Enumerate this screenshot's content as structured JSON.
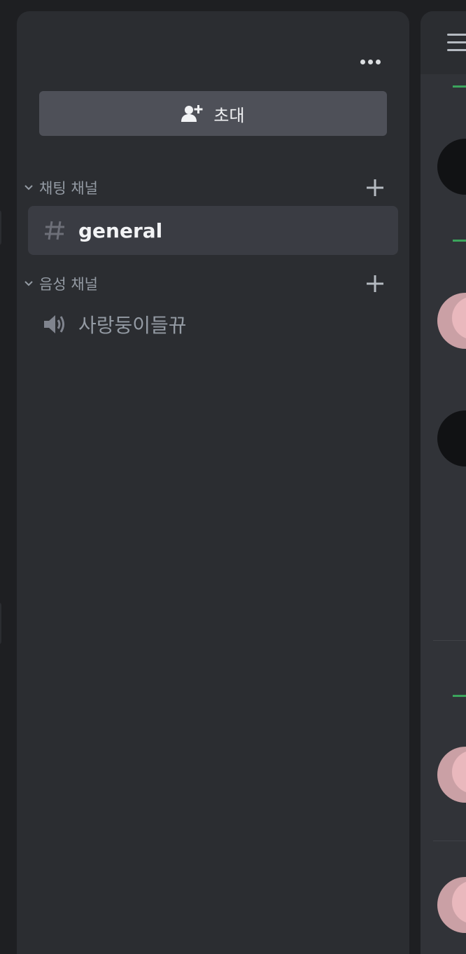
{
  "panel": {
    "more_icon": "more-horizontal-icon",
    "invite": {
      "label": "초대",
      "icon": "add-user-icon"
    },
    "categories": [
      {
        "label": "채팅 채널",
        "chevron_icon": "chevron-down-icon",
        "add_icon": "plus-icon",
        "channels": [
          {
            "label": "general",
            "icon": "hash-icon",
            "active": true
          }
        ]
      },
      {
        "label": "음성 채널",
        "chevron_icon": "chevron-down-icon",
        "add_icon": "plus-icon",
        "channels": [
          {
            "label": "사랑둥이들뀨",
            "icon": "speaker-icon",
            "active": false
          }
        ]
      }
    ]
  },
  "chat_peek": {
    "menu_icon": "hamburger-menu-icon"
  },
  "colors": {
    "background": "#1e1f22",
    "panel": "#2b2d31",
    "invite_button": "#4e5058",
    "active_channel": "#3a3c43",
    "muted_text": "#949ba4",
    "bright_text": "#f2f3f5",
    "online_green": "#3ba55c"
  }
}
